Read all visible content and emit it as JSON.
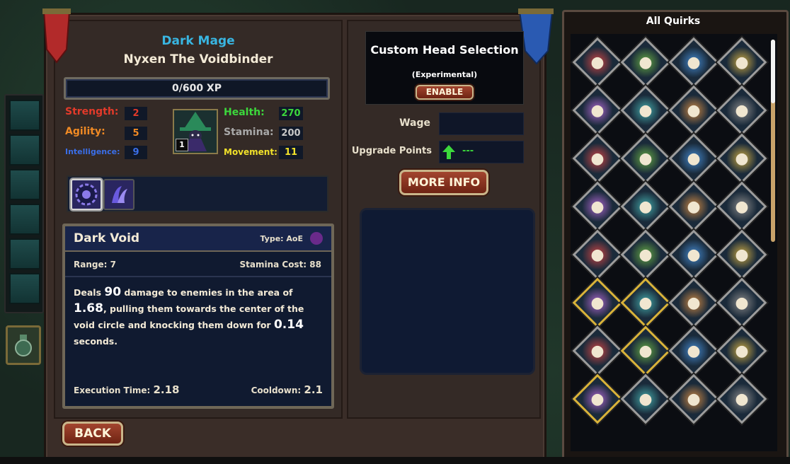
{
  "character": {
    "class": "Dark Mage",
    "name": "Nyxen The Voidbinder",
    "xp": "0/600 XP",
    "level": "1"
  },
  "stats": {
    "strength": {
      "label": "Strength:",
      "value": "2",
      "color": "#e23a2a"
    },
    "agility": {
      "label": "Agility:",
      "value": "5",
      "color": "#f08a24"
    },
    "intelligence": {
      "label": "Intelligence:",
      "value": "9",
      "color": "#3a6ee8"
    },
    "health": {
      "label": "Health:",
      "value": "270",
      "color": "#3cd83c"
    },
    "stamina": {
      "label": "Stamina:",
      "value": "200",
      "color": "#a8a8a8"
    },
    "movement": {
      "label": "Movement:",
      "value": "11",
      "color": "#f2e22a"
    }
  },
  "skills": [
    {
      "icon": "void-vortex-icon",
      "selected": true
    },
    {
      "icon": "void-claw-icon",
      "selected": false
    }
  ],
  "ability": {
    "name": "Dark Void",
    "type": "Type: AoE",
    "range": "Range: 7",
    "stamina_cost": "Stamina Cost: 88",
    "desc_1": "Deals ",
    "damage": "90",
    "desc_2": " damage to enemies in the area of ",
    "area": "1.68",
    "desc_3": ", pulling them towards the center of the void circle and knocking them down for ",
    "duration": "0.14",
    "desc_4": " seconds.",
    "execution_label": "Execution Time:",
    "execution_value": "2.18",
    "cooldown_label": "Cooldown:",
    "cooldown_value": "2.1"
  },
  "custom_head": {
    "title": "Custom Head Selection",
    "subtitle": "(Experimental)",
    "enable_label": "ENABLE"
  },
  "wage": {
    "label": "Wage",
    "value": ""
  },
  "upgrade_points": {
    "label": "Upgrade Points",
    "value": "---",
    "color": "#3cd83c"
  },
  "more_info_label": "MORE INFO",
  "back_label": "BACK",
  "quirks": {
    "title": "All Quirks",
    "items": [
      {
        "icon": "goblin-warrior-icon",
        "gold": false
      },
      {
        "icon": "grimacing-face-icon",
        "gold": false
      },
      {
        "icon": "skull-icon",
        "gold": false
      },
      {
        "icon": "goblin-gunner-icon",
        "gold": false
      },
      {
        "icon": "red-bird-icon",
        "gold": false
      },
      {
        "icon": "fanged-face-icon",
        "gold": false
      },
      {
        "icon": "zombie-face-icon",
        "gold": false
      },
      {
        "icon": "green-ogre-icon",
        "gold": false
      },
      {
        "icon": "wings-icon",
        "gold": false
      },
      {
        "icon": "red-demon-icon",
        "gold": false
      },
      {
        "icon": "fist-icon",
        "gold": false
      },
      {
        "icon": "mace-icon",
        "gold": false
      },
      {
        "icon": "flexed-arm-icon",
        "gold": false
      },
      {
        "icon": "green-fist-icon",
        "gold": false
      },
      {
        "icon": "sword-icon",
        "gold": false
      },
      {
        "icon": "torch-upgrade-icon",
        "gold": false
      },
      {
        "icon": "muscle-body-icon",
        "gold": false
      },
      {
        "icon": "ice-shard-icon",
        "gold": false
      },
      {
        "icon": "red-target-icon",
        "gold": false
      },
      {
        "icon": "green-monster-icon",
        "gold": false
      },
      {
        "icon": "soldier-face-icon",
        "gold": true
      },
      {
        "icon": "beast-face-icon",
        "gold": true
      },
      {
        "icon": "winged-crown-icon",
        "gold": false
      },
      {
        "icon": "lungs-icon",
        "gold": false
      },
      {
        "icon": "grinning-man-icon",
        "gold": false
      },
      {
        "icon": "house-icon",
        "gold": true
      },
      {
        "icon": "handshake-icon",
        "gold": false
      },
      {
        "icon": "punk-woman-icon",
        "gold": false
      },
      {
        "icon": "hooded-figure-icon",
        "gold": true
      },
      {
        "icon": "witch-icon",
        "gold": false
      },
      {
        "icon": "coins-hand-icon",
        "gold": false
      },
      {
        "icon": "injured-hand-icon",
        "gold": false
      }
    ]
  },
  "colors": {
    "class_title": "#39b6e2",
    "button_red": "#8a3320",
    "frame_brown": "#3a2d28",
    "panel_navy": "#101a30"
  }
}
